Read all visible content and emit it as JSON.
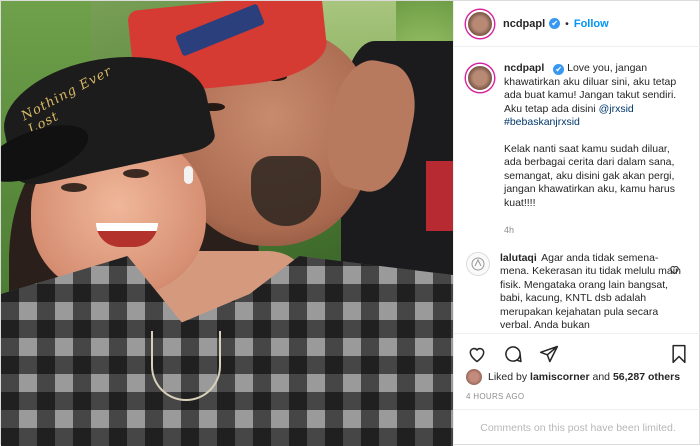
{
  "post": {
    "username": "ncdpapl",
    "follow_label": "Follow",
    "dot": "•",
    "verified_glyph": "✔",
    "photo_cap_text": "Nothing Ever Lost"
  },
  "caption": {
    "username": "ncdpapl",
    "text_1": "Love you, jangan khawatirkan aku diluar sini, aku tetap ada buat kamu! Jangan takut sendiri. Aku tetap ada disini",
    "mention": "@jrxsid",
    "hashtag": "#bebaskanjrxsid",
    "text_2": "Kelak nanti saat kamu sudah diluar, ada berbagai cerita dari dalam sana, semangat, aku disini gak akan pergi, jangan khawatirkan aku, kamu harus kuat!!!!",
    "time": "4h"
  },
  "comment": {
    "username": "lalutaqi",
    "text": "Agar anda tidak semena-mena. Kekerasan itu tidak melulu main fisik. Mengataka orang lain bangsat, babi, kacung, KNTL dsb adalah merupakan kejahatan pula secara verbal. Anda bukan"
  },
  "engagement": {
    "liked_by_prefix": "Liked by",
    "liked_by_user": "lamiscorner",
    "and": "and",
    "others_count": "56,287 others",
    "posted_ago": "4 HOURS AGO",
    "comments_limited": "Comments on this post have been limited."
  },
  "colors": {
    "accent": "#0095f6",
    "verified": "#3897f0",
    "muted": "#8e8e8e"
  }
}
